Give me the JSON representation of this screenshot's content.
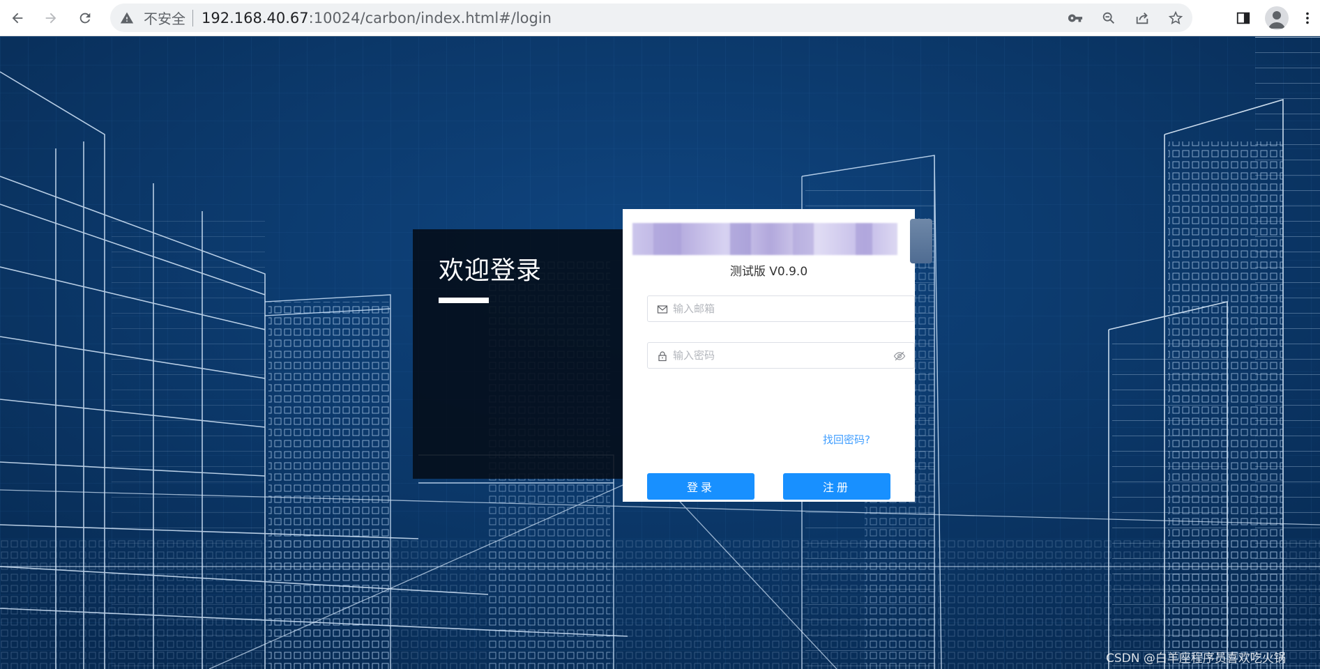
{
  "browser": {
    "security_label": "不安全",
    "url_host": "192.168.40.67",
    "url_path": ":10024/carbon/index.html#/login",
    "icons": [
      "back-arrow-icon",
      "forward-arrow-icon",
      "reload-icon",
      "warning-icon",
      "key-icon",
      "zoom-icon",
      "share-icon",
      "star-icon",
      "side-panel-icon",
      "profile-icon",
      "menu-icon"
    ]
  },
  "page": {
    "welcome_title": "欢迎登录",
    "version_label": "测试版 V0.9.0",
    "email_placeholder": "输入邮箱",
    "password_placeholder": "输入密码",
    "forgot_link": "找回密码?",
    "login_button": "登录",
    "register_button": "注册",
    "watermark": "CSDN @白羊座程序员喜欢吃火锅"
  },
  "colors": {
    "accent": "#1890ff",
    "link": "#409eff",
    "background": "#0a3563"
  }
}
